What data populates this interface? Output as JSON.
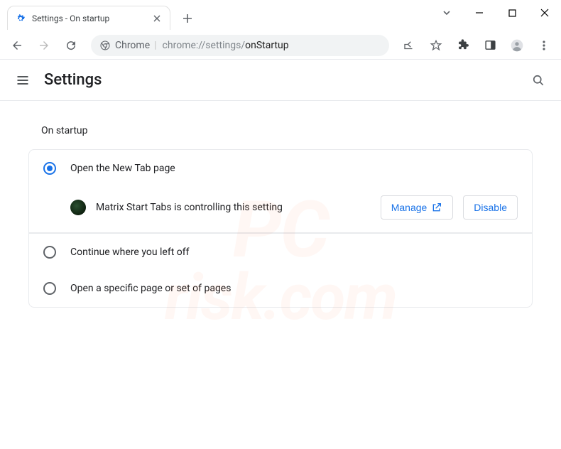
{
  "window": {
    "tab_title": "Settings - On startup",
    "caret_label": "v",
    "minimize": "—",
    "maximize": "□",
    "close": "✕"
  },
  "toolbar": {
    "site_label": "Chrome",
    "url_prefix": "chrome://settings/",
    "url_page": "onStartup"
  },
  "header": {
    "title": "Settings"
  },
  "section": {
    "title": "On startup",
    "options": [
      {
        "label": "Open the New Tab page",
        "selected": true
      },
      {
        "label": "Continue where you left off",
        "selected": false
      },
      {
        "label": "Open a specific page or set of pages",
        "selected": false
      }
    ],
    "extension": {
      "name": "Matrix Start Tabs",
      "message": "Matrix Start Tabs is controlling this setting",
      "manage_label": "Manage",
      "disable_label": "Disable"
    }
  },
  "watermark": {
    "line1": "PC",
    "line2": "risk.com"
  }
}
